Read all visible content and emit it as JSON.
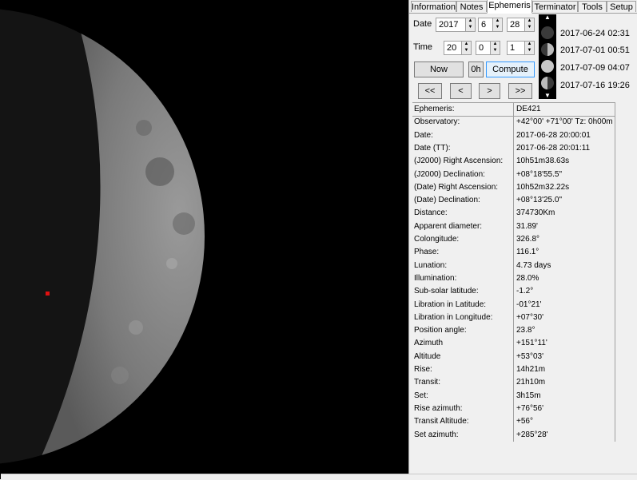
{
  "tabs": [
    "Information",
    "Notes",
    "Ephemeris",
    "Terminator",
    "Tools",
    "Setup"
  ],
  "active_tab": "Ephemeris",
  "date_row": {
    "label": "Date",
    "year": "2017",
    "month": "6",
    "day": "28"
  },
  "time_row": {
    "label": "Time",
    "hour": "20",
    "minute": "0",
    "second": "1"
  },
  "buttons": {
    "now": "Now",
    "zero_h": "0h",
    "compute": "Compute",
    "first": "<<",
    "prev": "<",
    "next": ">",
    "last": ">>"
  },
  "phase_dates": [
    "2017-06-24 02:31",
    "2017-07-01 00:51",
    "2017-07-09 04:07",
    "2017-07-16 19:26"
  ],
  "ephemeris": [
    {
      "k": "Ephemeris:",
      "v": "DE421"
    },
    {
      "k": "Observatory:",
      "v": "+42°00' +71°00' Tz:  0h00m"
    },
    {
      "k": "Date:",
      "v": "2017-06-28 20:00:01"
    },
    {
      "k": "Date (TT):",
      "v": "2017-06-28 20:01:11"
    },
    {
      "k": "(J2000) Right Ascension:",
      "v": " 10h51m38.63s"
    },
    {
      "k": "(J2000) Declination:",
      "v": "+08°18'55.5\""
    },
    {
      "k": "(Date) Right Ascension:",
      "v": " 10h52m32.22s"
    },
    {
      "k": "(Date) Declination:",
      "v": "+08°13'25.0\""
    },
    {
      "k": "Distance:",
      "v": "374730Km"
    },
    {
      "k": "Apparent diameter:",
      "v": "31.89'"
    },
    {
      "k": "Colongitude:",
      "v": "326.8°"
    },
    {
      "k": "Phase:",
      "v": "116.1°"
    },
    {
      "k": "Lunation:",
      "v": "4.73 days"
    },
    {
      "k": "Illumination:",
      "v": "28.0%"
    },
    {
      "k": "Sub-solar latitude:",
      "v": "-1.2°"
    },
    {
      "k": "Libration in Latitude:",
      "v": "-01°21'"
    },
    {
      "k": "Libration in Longitude:",
      "v": "+07°30'"
    },
    {
      "k": "Position angle:",
      "v": "23.8°"
    },
    {
      "k": "Azimuth",
      "v": "+151°11'"
    },
    {
      "k": "Altitude",
      "v": "+53°03'"
    },
    {
      "k": "Rise:",
      "v": " 14h21m"
    },
    {
      "k": "Transit:",
      "v": " 21h10m"
    },
    {
      "k": "Set:",
      "v": " 3h15m"
    },
    {
      "k": "Rise azimuth:",
      "v": "+76°56'"
    },
    {
      "k": "Transit Altitude:",
      "v": "+56°"
    },
    {
      "k": "Set azimuth:",
      "v": "+285°28'"
    }
  ]
}
